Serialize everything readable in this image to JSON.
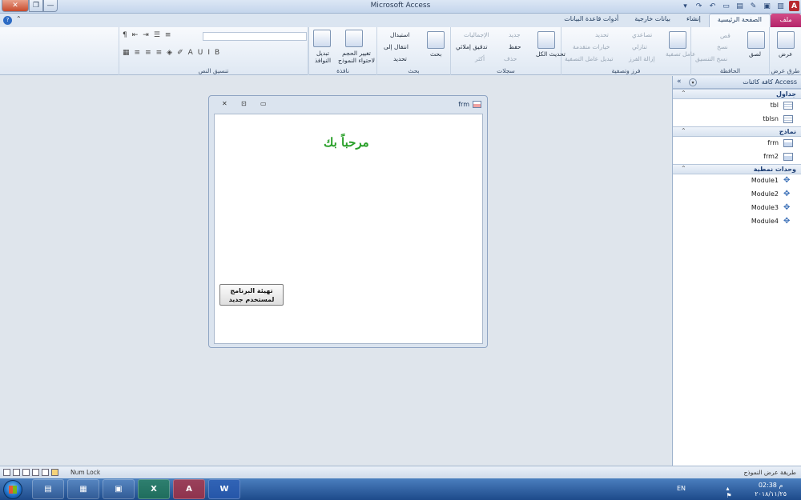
{
  "window": {
    "title": "Microsoft Access",
    "close_label": "✕",
    "max_label": "❐",
    "min_label": "—"
  },
  "tabs": [
    "ملف",
    "الصفحة الرئيسية",
    "إنشاء",
    "بيانات خارجية",
    "أدوات قاعدة البيانات"
  ],
  "ribbon": {
    "views": {
      "label": "عرض",
      "group": "طرق عرض"
    },
    "clipboard": {
      "paste": "لصق",
      "cut": "قص",
      "copy": "نسخ",
      "format_painter": "نسخ التنسيق",
      "group": "الحافظة"
    },
    "sort_filter": {
      "filter": "عامل تصفية",
      "ascending": "تصاعدي",
      "descending": "تنازلي",
      "remove_sort": "إزالة الفرز",
      "selection": "تحديد",
      "advanced": "خيارات متقدمة",
      "toggle_filter": "تبديل عامل التصفية",
      "group": "فرز وتصفية"
    },
    "records": {
      "refresh_all": "تحديث الكل",
      "new": "جديد",
      "save": "حفظ",
      "delete": "حذف",
      "totals": "الإجماليات",
      "spelling": "تدقيق إملائي",
      "more": "أكثر",
      "group": "سجلات"
    },
    "find": {
      "find": "بحث",
      "replace": "استبدال",
      "goto": "انتقال إلى",
      "select": "تحديد",
      "group": "بحث"
    },
    "window": {
      "size_to_fit": "تغيير الحجم لاحتواء النموذج",
      "switch": "تبديل النوافذ",
      "group": "نافذة"
    },
    "text_format": {
      "group": "تنسيق النص"
    }
  },
  "nav": {
    "title": "كافة كائنات Access",
    "sections": [
      {
        "title": "جداول",
        "items": [
          "tbl",
          "tblsn"
        ]
      },
      {
        "title": "نماذج",
        "items": [
          "frm",
          "frm2"
        ]
      },
      {
        "title": "وحدات نمطية",
        "items": [
          "Module1",
          "Module2",
          "Module3",
          "Module4"
        ]
      }
    ]
  },
  "form": {
    "title": "frm",
    "welcome": "مرحباً بك",
    "init_button_line1": "تهيئة البرنامج",
    "init_button_line2": "لمستخدم جديد"
  },
  "status": {
    "numlock": "Num Lock",
    "view": "طريقة عرض النموذج"
  },
  "taskbar": {
    "lang": "EN",
    "time": "02:38 م",
    "date": "٢٠١٨/١١/٢٥"
  }
}
